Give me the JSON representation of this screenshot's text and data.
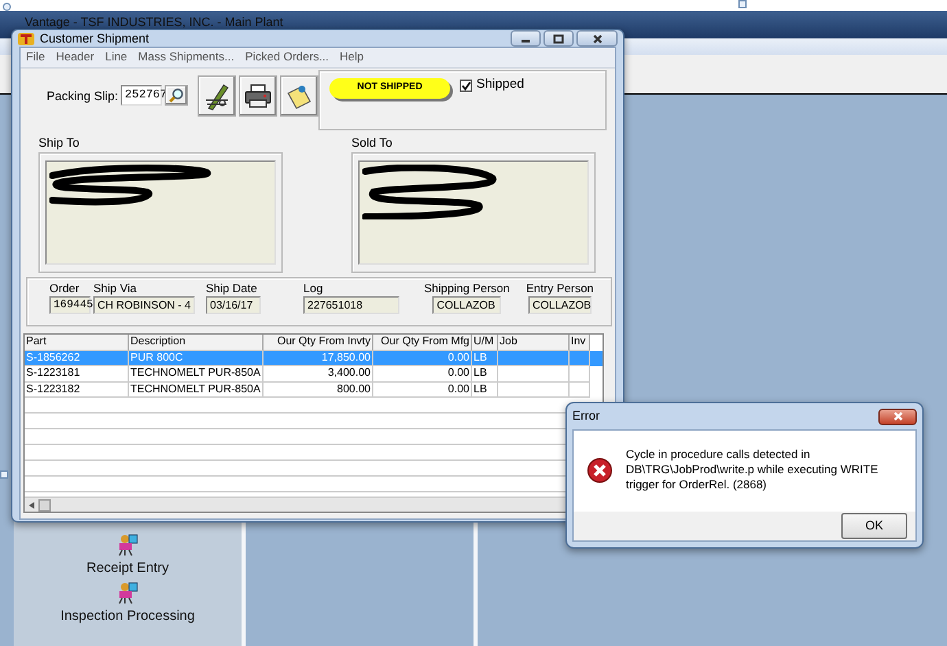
{
  "main_window": {
    "title": "Vantage - TSF INDUSTRIES, INC. - Main Plant"
  },
  "shipment_window": {
    "title": "Customer Shipment",
    "menu": [
      "File",
      "Header",
      "Line",
      "Mass Shipments...",
      "Picked Orders...",
      "Help"
    ],
    "packing_slip": {
      "label": "Packing Slip:",
      "value": "252767"
    },
    "status_badge": "NOT SHIPPED",
    "shipped": {
      "label": "Shipped",
      "checked": true
    },
    "ship_to": {
      "label": "Ship To"
    },
    "sold_to": {
      "label": "Sold To"
    },
    "fields": [
      {
        "label": "Order",
        "value": "169445"
      },
      {
        "label": "Ship Via",
        "value": "CH ROBINSON - 4"
      },
      {
        "label": "Ship Date",
        "value": "03/16/17"
      },
      {
        "label": "Log",
        "value": "227651018"
      },
      {
        "label": "Shipping Person",
        "value": "COLLAZOB"
      },
      {
        "label": "Entry Person",
        "value": "COLLAZOB"
      }
    ],
    "table": {
      "columns": [
        "Part",
        "Description",
        "Our Qty From Invty",
        "Our Qty From Mfg",
        "U/M",
        "Job",
        "Inv"
      ],
      "rows": [
        {
          "cells": [
            "S-1856262",
            "PUR 800C",
            "17,850.00",
            "0.00",
            "LB"
          ],
          "selected": true
        },
        {
          "cells": [
            "S-1223181",
            "TECHNOMELT PUR-850A",
            "3,400.00",
            "0.00",
            "LB"
          ],
          "selected": false
        },
        {
          "cells": [
            "S-1223182",
            "TECHNOMELT PUR-850A",
            "800.00",
            "0.00",
            "LB"
          ],
          "selected": false
        }
      ]
    }
  },
  "sidebar": {
    "items": [
      {
        "label": "Receipt Entry"
      },
      {
        "label": "Inspection Processing"
      }
    ]
  },
  "error_dialog": {
    "title": "Error",
    "message": "Cycle in procedure calls detected in DB\\TRG\\JobProd\\write.p while executing WRITE trigger for OrderRel. (2868)",
    "buttons": [
      "OK"
    ]
  }
}
